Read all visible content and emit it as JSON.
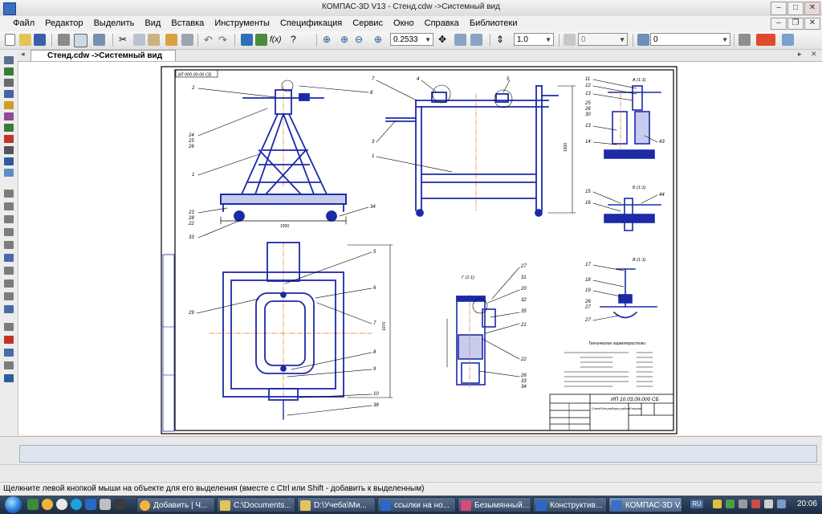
{
  "window": {
    "title": "КОМПАС-3D V13 - Стенд.cdw ->Системный вид",
    "controls": [
      "–",
      "□",
      "✕"
    ]
  },
  "menu": [
    "Файл",
    "Редактор",
    "Выделить",
    "Вид",
    "Вставка",
    "Инструменты",
    "Спецификация",
    "Сервис",
    "Окно",
    "Справка",
    "Библиотеки"
  ],
  "toolbar": {
    "zoom_value": "0.2533",
    "step_value": "1.0",
    "style_value": "0",
    "layer_value": "0"
  },
  "document": {
    "tab_label": "Стенд.cdw ->Системный вид"
  },
  "drawing": {
    "code_stamp": "ЭЛ 000.00.00 СБ",
    "title_block_code": "ИП 10.03.09.000 СБ",
    "title_block_name": "Стенд для разборки рабочей втулки",
    "tech_heading": "Технические характеристики",
    "section_labels": [
      "А (1:1)",
      "Б (1:1)",
      "В (1:1)",
      "Г (1:1)"
    ],
    "dims": [
      "1000",
      "1500",
      "1070"
    ],
    "callouts_front": [
      "2",
      "8",
      "24",
      "25",
      "26",
      "1",
      "23",
      "28",
      "22",
      "33",
      "34"
    ],
    "callouts_side": [
      "7",
      "4",
      "5",
      "3",
      "1"
    ],
    "callouts_plan": [
      "5",
      "6",
      "29",
      "7",
      "8",
      "9",
      "10",
      "38"
    ],
    "callouts_sectA": [
      "11",
      "12",
      "13",
      "25",
      "26",
      "30",
      "13",
      "14",
      "43"
    ],
    "callouts_sectB": [
      "15",
      "16",
      "44"
    ],
    "callouts_sectV": [
      "17",
      "18",
      "19",
      "26",
      "27",
      "27"
    ],
    "callouts_sectG": [
      "27",
      "31",
      "20",
      "32",
      "35",
      "21",
      "22",
      "26",
      "33",
      "34"
    ]
  },
  "status": {
    "hint": "Щелкните левой кнопкой мыши на объекте для его выделения (вместе с Ctrl или Shift - добавить к выделенным)"
  },
  "taskbar": {
    "tasks": [
      "Добавить | Ч...",
      "C:\\Documents...",
      "D:\\Учеба\\Ми...",
      "ссылки на но...",
      "Безымянный...",
      "Конструктив...",
      "КОМПАС-3D V..."
    ],
    "lang": "RU",
    "clock": "20:06"
  }
}
